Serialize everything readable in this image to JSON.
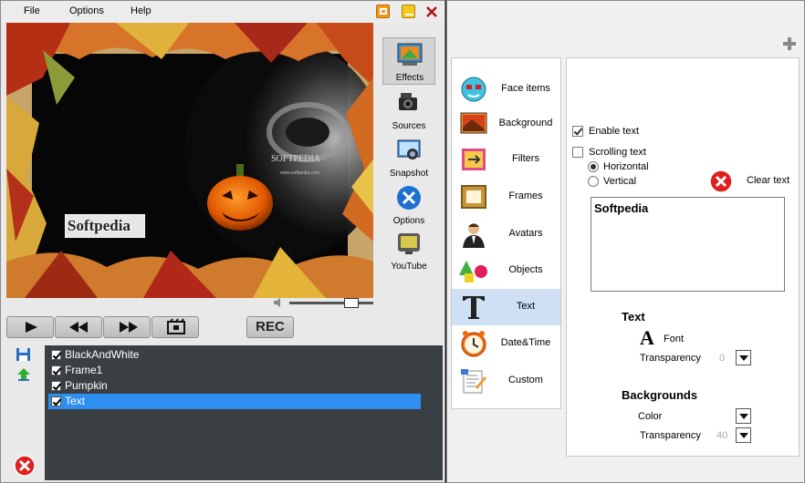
{
  "menu": {
    "file": "File",
    "options": "Options",
    "help": "Help"
  },
  "preview": {
    "overlay_text": "Softpedia",
    "watermark": "SOFTPEDIA",
    "watermark_url": "www.softpedia.com"
  },
  "side_tools": [
    {
      "label": "Effects",
      "icon": "effects-icon",
      "active": true
    },
    {
      "label": "Sources",
      "icon": "sources-icon",
      "active": false
    },
    {
      "label": "Snapshot",
      "icon": "snapshot-icon",
      "active": false
    },
    {
      "label": "Options",
      "icon": "options-icon",
      "active": false
    },
    {
      "label": "YouTube",
      "icon": "youtube-icon",
      "active": false
    }
  ],
  "controls": {
    "rec_label": "REC"
  },
  "layers": [
    {
      "name": "BlackAndWhite",
      "checked": true,
      "selected": false
    },
    {
      "name": "Frame1",
      "checked": true,
      "selected": false
    },
    {
      "name": "Pumpkin",
      "checked": true,
      "selected": false
    },
    {
      "name": "Text",
      "checked": true,
      "selected": true
    }
  ],
  "categories": [
    {
      "label": "Face items",
      "icon": "face-items-icon"
    },
    {
      "label": "Background",
      "icon": "background-icon"
    },
    {
      "label": "Filters",
      "icon": "filters-icon"
    },
    {
      "label": "Frames",
      "icon": "frames-icon"
    },
    {
      "label": "Avatars",
      "icon": "avatars-icon"
    },
    {
      "label": "Objects",
      "icon": "objects-icon"
    },
    {
      "label": "Text",
      "icon": "text-icon",
      "selected": true
    },
    {
      "label": "Date&Time",
      "icon": "clock-icon"
    },
    {
      "label": "Custom",
      "icon": "custom-icon"
    }
  ],
  "settings": {
    "enable_text": "Enable text",
    "scrolling_text": "Scrolling text",
    "horizontal": "Horizontal",
    "vertical": "Vertical",
    "clear_text": "Clear text",
    "text_value": "Softpedia",
    "text_section": "Text",
    "font_label": "Font",
    "transparency_label": "Transparency",
    "text_transparency": "0",
    "backgrounds_section": "Backgrounds",
    "color_label": "Color",
    "bg_transparency_label": "Transparency",
    "bg_transparency": "40"
  },
  "colors": {
    "accent_blue": "#2e8ff0",
    "layer_bg": "#3a3f44",
    "selected_category": "#cfe0f5",
    "close_red": "#e02020"
  }
}
